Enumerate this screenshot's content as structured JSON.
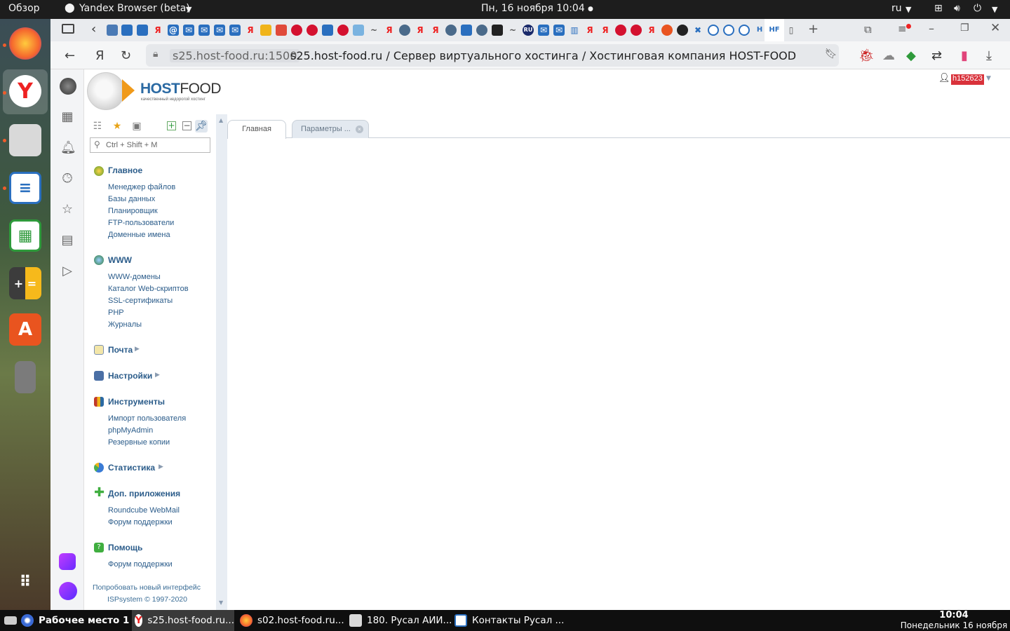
{
  "topbar": {
    "activities": "Обзор",
    "app_name": "Yandex Browser (beta)",
    "datetime": "Пн, 16 ноября  10:04",
    "lang": "ru"
  },
  "browser": {
    "url_host": "s25.host-food.ru:1500",
    "url_title": "s25.host-food.ru / Сервер виртуального хостинга / Хостинговая компания HOST-FOOD"
  },
  "logo": {
    "brand_bold": "HOST",
    "brand_light": "FOOD",
    "tagline": "качественный недорогой хостинг"
  },
  "user": {
    "login": "h152623"
  },
  "search": {
    "placeholder": "Ctrl + Shift + M"
  },
  "tabs": [
    {
      "label": "Главная"
    },
    {
      "label": "Параметры ..."
    }
  ],
  "menu": {
    "main": {
      "title": "Главное",
      "items": [
        "Менеджер файлов",
        "Базы данных",
        "Планировщик",
        "FTP-пользователи",
        "Доменные имена"
      ]
    },
    "www": {
      "title": "WWW",
      "items": [
        "WWW-домены",
        "Каталог Web-скриптов",
        "SSL-сертификаты",
        "PHP",
        "Журналы"
      ]
    },
    "mail": {
      "title": "Почта"
    },
    "settings": {
      "title": "Настройки"
    },
    "tools": {
      "title": "Инструменты",
      "items": [
        "Импорт пользователя",
        "phpMyAdmin",
        "Резервные копии"
      ]
    },
    "stats": {
      "title": "Статистика"
    },
    "apps": {
      "title": "Доп. приложения",
      "items": [
        "Roundcube WebMail",
        "Форум поддержки"
      ]
    },
    "help": {
      "title": "Помощь",
      "items": [
        "Форум поддержки"
      ]
    }
  },
  "footer": {
    "try_new": "Попробовать новый интерфейс",
    "copyright": "ISPsystem © 1997-2020"
  },
  "taskbar": {
    "workspace": "Рабочее место 1",
    "tasks": [
      "s25.host-food.ru...",
      "s02.host-food.ru...",
      "180. Русал АИИ...",
      "Контакты Русал ..."
    ],
    "time": "10:04",
    "date": "Понедельник 16 ноября"
  },
  "colors": {
    "accent_link": "#2b5c8a",
    "logo_orange": "#f09a1a",
    "user_badge": "#d9323b"
  }
}
